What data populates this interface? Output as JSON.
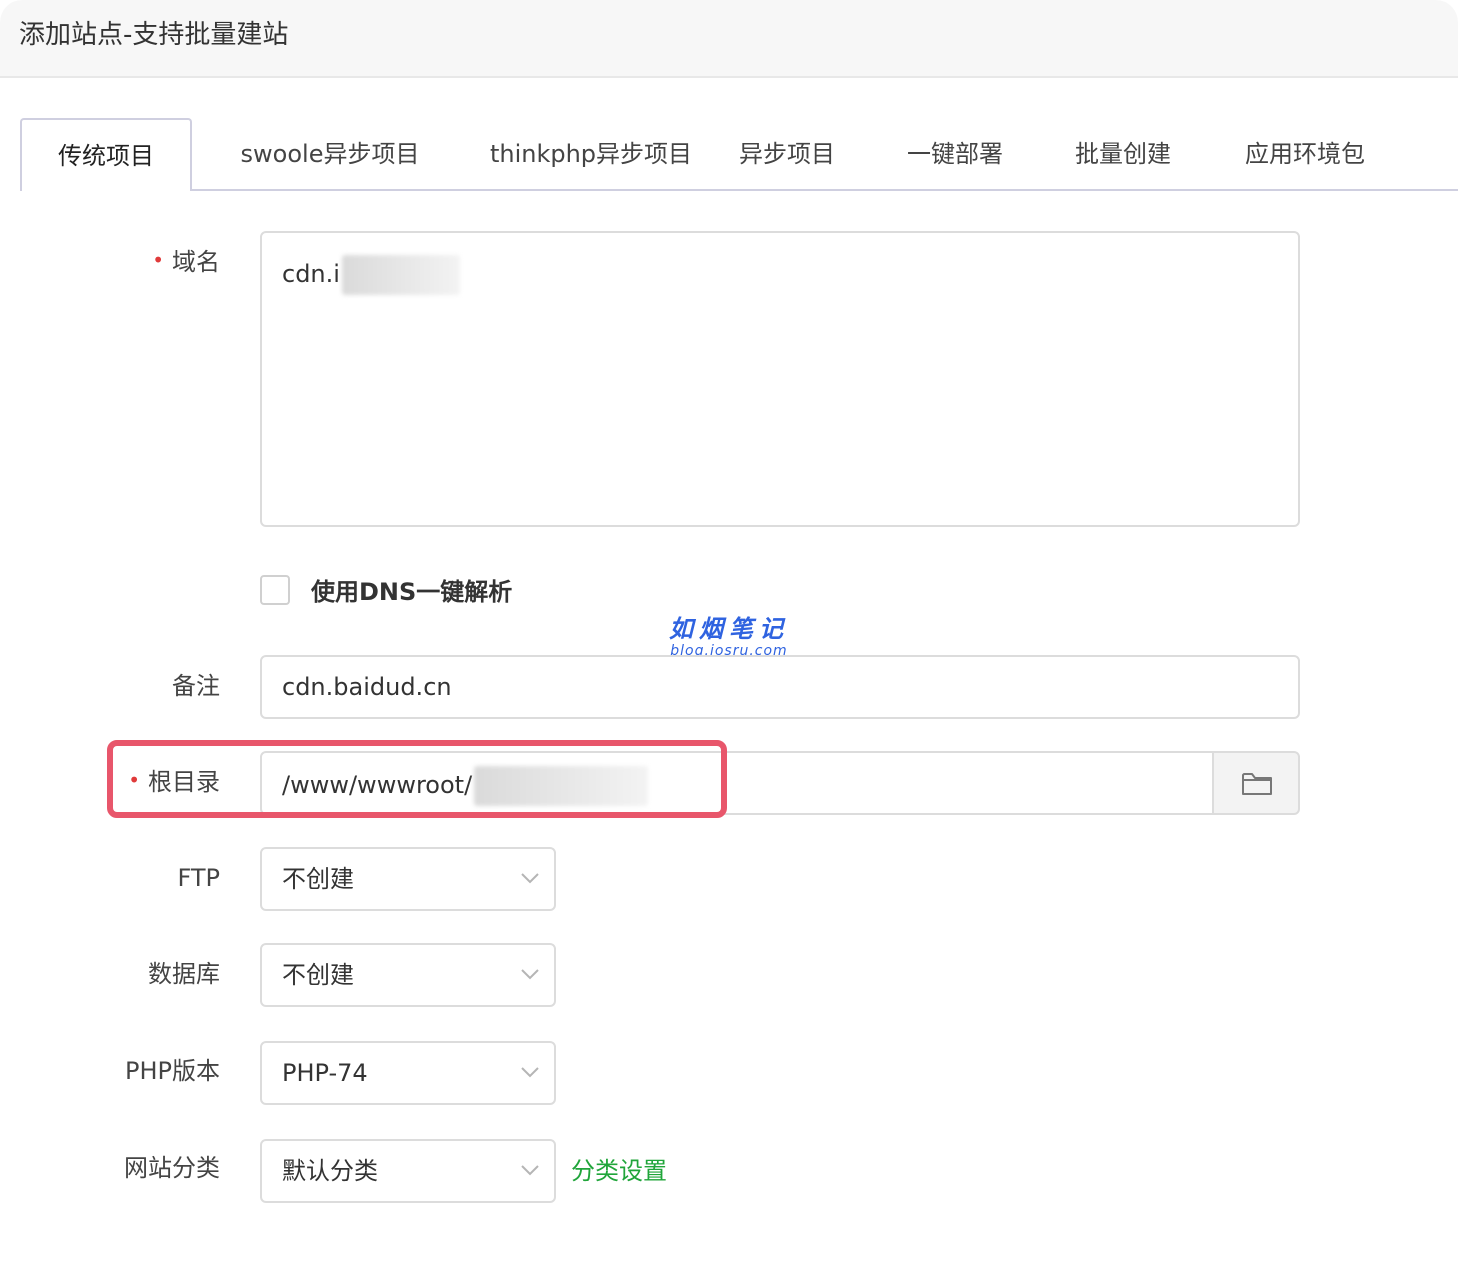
{
  "dialog": {
    "title": "添加站点-支持批量建站"
  },
  "tabs": [
    {
      "label": "传统项目",
      "active": true
    },
    {
      "label": "swoole异步项目",
      "active": false
    },
    {
      "label": "thinkphp异步项目",
      "active": false
    },
    {
      "label": "异步项目",
      "active": false
    },
    {
      "label": "一键部署",
      "active": false
    },
    {
      "label": "批量创建",
      "active": false
    },
    {
      "label": "应用环境包",
      "active": false
    }
  ],
  "form": {
    "required_mark": "•",
    "domain": {
      "label": "域名",
      "value": "cdn.i"
    },
    "dns": {
      "label": "使用DNS一键解析",
      "checked": false
    },
    "remark": {
      "label": "备注",
      "value": "cdn.baidud.cn"
    },
    "root_dir": {
      "label": "根目录",
      "value": "/www/wwwroot/",
      "button_icon": "folder-icon"
    },
    "ftp": {
      "label": "FTP",
      "value": "不创建"
    },
    "database": {
      "label": "数据库",
      "value": "不创建"
    },
    "php": {
      "label": "PHP版本",
      "value": "PHP-74"
    },
    "category": {
      "label": "网站分类",
      "value": "默认分类",
      "settings_link": "分类设置"
    }
  },
  "watermark": {
    "title": "如烟笔记",
    "url": "blog.iosru.com"
  },
  "colors": {
    "required": "#e03a3a",
    "highlight": "#e8566b",
    "link": "#20a53a",
    "watermark": "#2f63e0"
  }
}
